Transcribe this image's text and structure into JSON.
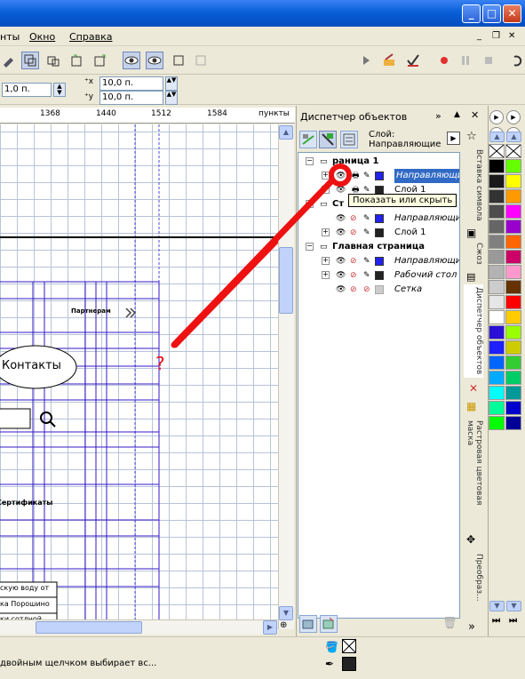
{
  "menu": {
    "items": [
      "нты",
      "Окно",
      "Справка"
    ]
  },
  "window_buttons": {
    "min": "_",
    "max": "□",
    "close": "✕"
  },
  "mdi_buttons": {
    "min": "_",
    "restore": "❐",
    "close": "✕"
  },
  "propbar": {
    "size_value": "1,0 п.",
    "x_value": "10,0 п.",
    "y_value": "10,0 п."
  },
  "ruler": {
    "ticks": [
      "1368",
      "1440",
      "1512",
      "1584",
      "пункты"
    ]
  },
  "canvas": {
    "partners_label": "Партнерам",
    "contacts_label": "Контакты",
    "certificates_label": "Сертификаты",
    "table_rows": [
      "скую воду от",
      "ка Порошино",
      "ки сотлной"
    ],
    "question_mark": "?"
  },
  "docker": {
    "title": "Диспетчер объектов",
    "layer_label": "Слой:",
    "layer_name": "Направляющие",
    "tooltip": "Показать или скрыть",
    "tree": [
      {
        "label": "раница 1",
        "kind": "page"
      },
      {
        "label": "Направляющи",
        "kind": "layer",
        "color": "#2222ee",
        "selected": true
      },
      {
        "label": "Слой 1",
        "kind": "layer",
        "color": "#222222"
      },
      {
        "label": "Ст",
        "kind": "page"
      },
      {
        "label": "Направляющи",
        "kind": "layer",
        "color": "#2222ee"
      },
      {
        "label": "Слой 1",
        "kind": "layer",
        "color": "#222222"
      },
      {
        "label": "Главная страница",
        "kind": "page"
      },
      {
        "label": "Направляющи",
        "kind": "layer",
        "color": "#2222ee"
      },
      {
        "label": "Рабочий стол",
        "kind": "layer",
        "color": "#222222"
      },
      {
        "label": "Сетка",
        "kind": "layer",
        "color": "#cccccc"
      }
    ]
  },
  "vtabs": [
    "Вставка символа",
    "Сжоз",
    "Диспетчер объектов",
    "Растровая цветовая маска",
    "Преобраз..."
  ],
  "status": {
    "hint": "двойным щелчком выбирает вс..."
  },
  "palette": {
    "colors": [
      "#000000",
      "#1a1a1a",
      "#333333",
      "#4d4d4d",
      "#666666",
      "#808080",
      "#999999",
      "#b3b3b3",
      "#cccccc",
      "#e6e6e6",
      "#ffffff",
      "#2a0fd6",
      "#1f1fff",
      "#0066ff",
      "#00aaff",
      "#00ffff",
      "#00ff99",
      "#00ff00",
      "#66ff00",
      "#ffff00",
      "#ff9900",
      "#ff00ff",
      "#9900cc",
      "#ff6600",
      "#cc0066",
      "#ff99cc",
      "#663300",
      "#ff0000",
      "#ffcc00",
      "#99ff00",
      "#cccc00",
      "#33cc33",
      "#00cc66",
      "#009999",
      "#0000cc",
      "#000099"
    ]
  }
}
